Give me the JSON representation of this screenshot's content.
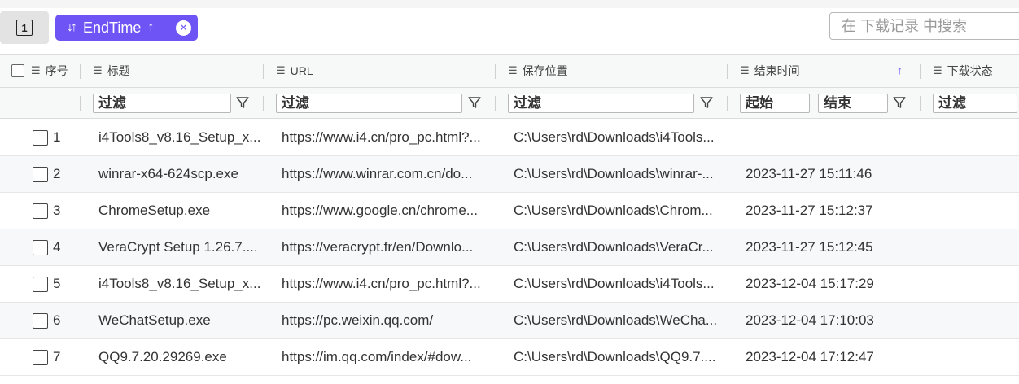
{
  "toolbar": {
    "selection_count": "1",
    "sort_chip": {
      "icon": "sort-icon",
      "field": "EndTime",
      "direction_arrow": "↑",
      "close_icon": "close-icon"
    },
    "search_placeholder": "在 下载记录 中搜索"
  },
  "table": {
    "columns": [
      {
        "key": "index",
        "label": "序号"
      },
      {
        "key": "title",
        "label": "标题"
      },
      {
        "key": "url",
        "label": "URL"
      },
      {
        "key": "location",
        "label": "保存位置"
      },
      {
        "key": "endtime",
        "label": "结束时间",
        "sorted": "asc"
      },
      {
        "key": "status",
        "label": "下载状态"
      }
    ],
    "filters": {
      "title": "过滤",
      "url": "过滤",
      "location": "过滤",
      "endtime_start": "起始",
      "endtime_end": "结束",
      "status": "过滤"
    },
    "rows": [
      {
        "index": "1",
        "title": "i4Tools8_v8.16_Setup_x...",
        "url": "https://www.i4.cn/pro_pc.html?...",
        "location": "C:\\Users\\rd\\Downloads\\i4Tools...",
        "endtime": ""
      },
      {
        "index": "2",
        "title": "winrar-x64-624scp.exe",
        "url": "https://www.winrar.com.cn/do...",
        "location": "C:\\Users\\rd\\Downloads\\winrar-...",
        "endtime": "2023-11-27 15:11:46"
      },
      {
        "index": "3",
        "title": "ChromeSetup.exe",
        "url": "https://www.google.cn/chrome...",
        "location": "C:\\Users\\rd\\Downloads\\Chrom...",
        "endtime": "2023-11-27 15:12:37"
      },
      {
        "index": "4",
        "title": "VeraCrypt Setup 1.26.7....",
        "url": "https://veracrypt.fr/en/Downlo...",
        "location": "C:\\Users\\rd\\Downloads\\VeraCr...",
        "endtime": "2023-11-27 15:12:45"
      },
      {
        "index": "5",
        "title": "i4Tools8_v8.16_Setup_x...",
        "url": "https://www.i4.cn/pro_pc.html?...",
        "location": "C:\\Users\\rd\\Downloads\\i4Tools...",
        "endtime": "2023-12-04 15:17:29"
      },
      {
        "index": "6",
        "title": "WeChatSetup.exe",
        "url": "https://pc.weixin.qq.com/",
        "location": "C:\\Users\\rd\\Downloads\\WeCha...",
        "endtime": "2023-12-04 17:10:03"
      },
      {
        "index": "7",
        "title": "QQ9.7.20.29269.exe",
        "url": "https://im.qq.com/index/#dow...",
        "location": "C:\\Users\\rd\\Downloads\\QQ9.7....",
        "endtime": "2023-12-04 17:12:47"
      }
    ]
  },
  "colors": {
    "accent": "#6e53f5",
    "header_bg": "#f7f8f8",
    "alt_row_bg": "#f7f8fa"
  }
}
